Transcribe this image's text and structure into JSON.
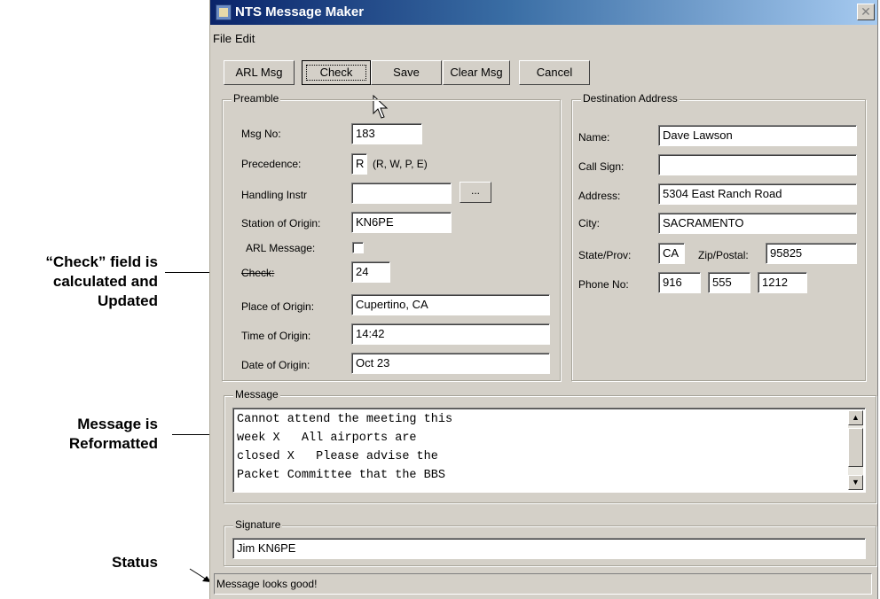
{
  "annotations": {
    "check_line1": "“Check” field is",
    "check_line2": "calculated and",
    "check_line3": "Updated",
    "message_line1": "Message is",
    "message_line2": "Reformatted",
    "status": "Status"
  },
  "window": {
    "title": "NTS Message Maker",
    "close": "✕"
  },
  "menu": {
    "file": "File",
    "edit": "Edit"
  },
  "toolbar": {
    "arl_msg": "ARL Msg",
    "check": "Check",
    "save": "Save",
    "clear_msg": "Clear Msg",
    "cancel": "Cancel"
  },
  "preamble": {
    "title": "Preamble",
    "msg_no_label": "Msg No:",
    "msg_no": "183",
    "precedence_label": "Precedence:",
    "precedence": "R",
    "precedence_hint": "(R, W, P, E)",
    "handling_label": "Handling Instr",
    "handling": "",
    "handling_btn": "...",
    "station_label": "Station of Origin:",
    "station": "KN6PE",
    "arl_label": "ARL Message:",
    "check_label": "Check:",
    "check": "24",
    "place_label": "Place of Origin:",
    "place": "Cupertino, CA",
    "time_label": "Time of Origin:",
    "time": "14:42",
    "date_label": "Date of Origin:",
    "date": "Oct 23"
  },
  "destination": {
    "title": "Destination Address",
    "name_label": "Name:",
    "name": "Dave Lawson",
    "callsign_label": "Call Sign:",
    "callsign": "",
    "address_label": "Address:",
    "address": "5304 East Ranch Road",
    "city_label": "City:",
    "city": "SACRAMENTO",
    "state_label": "State/Prov:",
    "state": "CA",
    "zip_label": "Zip/Postal:",
    "zip": "95825",
    "phone_label": "Phone No:",
    "phone1": "916",
    "phone2": "555",
    "phone3": "1212"
  },
  "message": {
    "title": "Message",
    "lines": [
      "Cannot attend the meeting this",
      "week X   All airports are",
      "closed X   Please advise the",
      "Packet Committee that the BBS"
    ]
  },
  "signature": {
    "title": "Signature",
    "value": "Jim KN6PE"
  },
  "status": {
    "text": "Message looks good!"
  }
}
